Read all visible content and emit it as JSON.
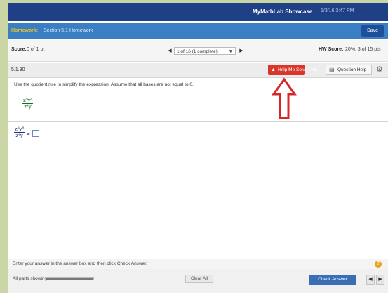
{
  "topbar": {
    "brand": "MyMathLab Showcase",
    "date": "1/3/16 3:47 PM"
  },
  "hw": {
    "label": "Homework:",
    "title": "Section 5.1 Homework",
    "save_label": "Save"
  },
  "score": {
    "label": "Score:",
    "value": "0 of 1 pt",
    "prev": "◀",
    "next": "▶",
    "question_selector": "1 of 16 (1 complete)",
    "caret": "▼",
    "hw_label": "HW Score:",
    "hw_value": "20%, 3 of 15 pts"
  },
  "question": {
    "number": "5.1.90",
    "help_me_solve": "Help Me Solve This",
    "help_icon": "warning-icon",
    "question_help": "Question Help",
    "question_help_icon": "panel-icon",
    "gear": "⚙",
    "instruction": "Use the quotient rule to simplify the expression. Assume that all bases are not equal to 0.",
    "expr_num": "z⁹y⁸",
    "expr_den": "z⁴y",
    "answer_num": "z⁹y⁸",
    "answer_den": "z⁴y",
    "equals": "="
  },
  "bottom": {
    "message": "Enter your answer in the answer box and then click Check Answer.",
    "help_glyph": "?",
    "parts_label": "All parts showing",
    "progress": 1.0,
    "clear_all": "Clear All",
    "check_answer": "Check Answer",
    "prev": "◀",
    "next": "▶"
  },
  "colors": {
    "accent": "#1f3f86",
    "help_btn": "#d9362b",
    "arrow": "#d62828"
  }
}
